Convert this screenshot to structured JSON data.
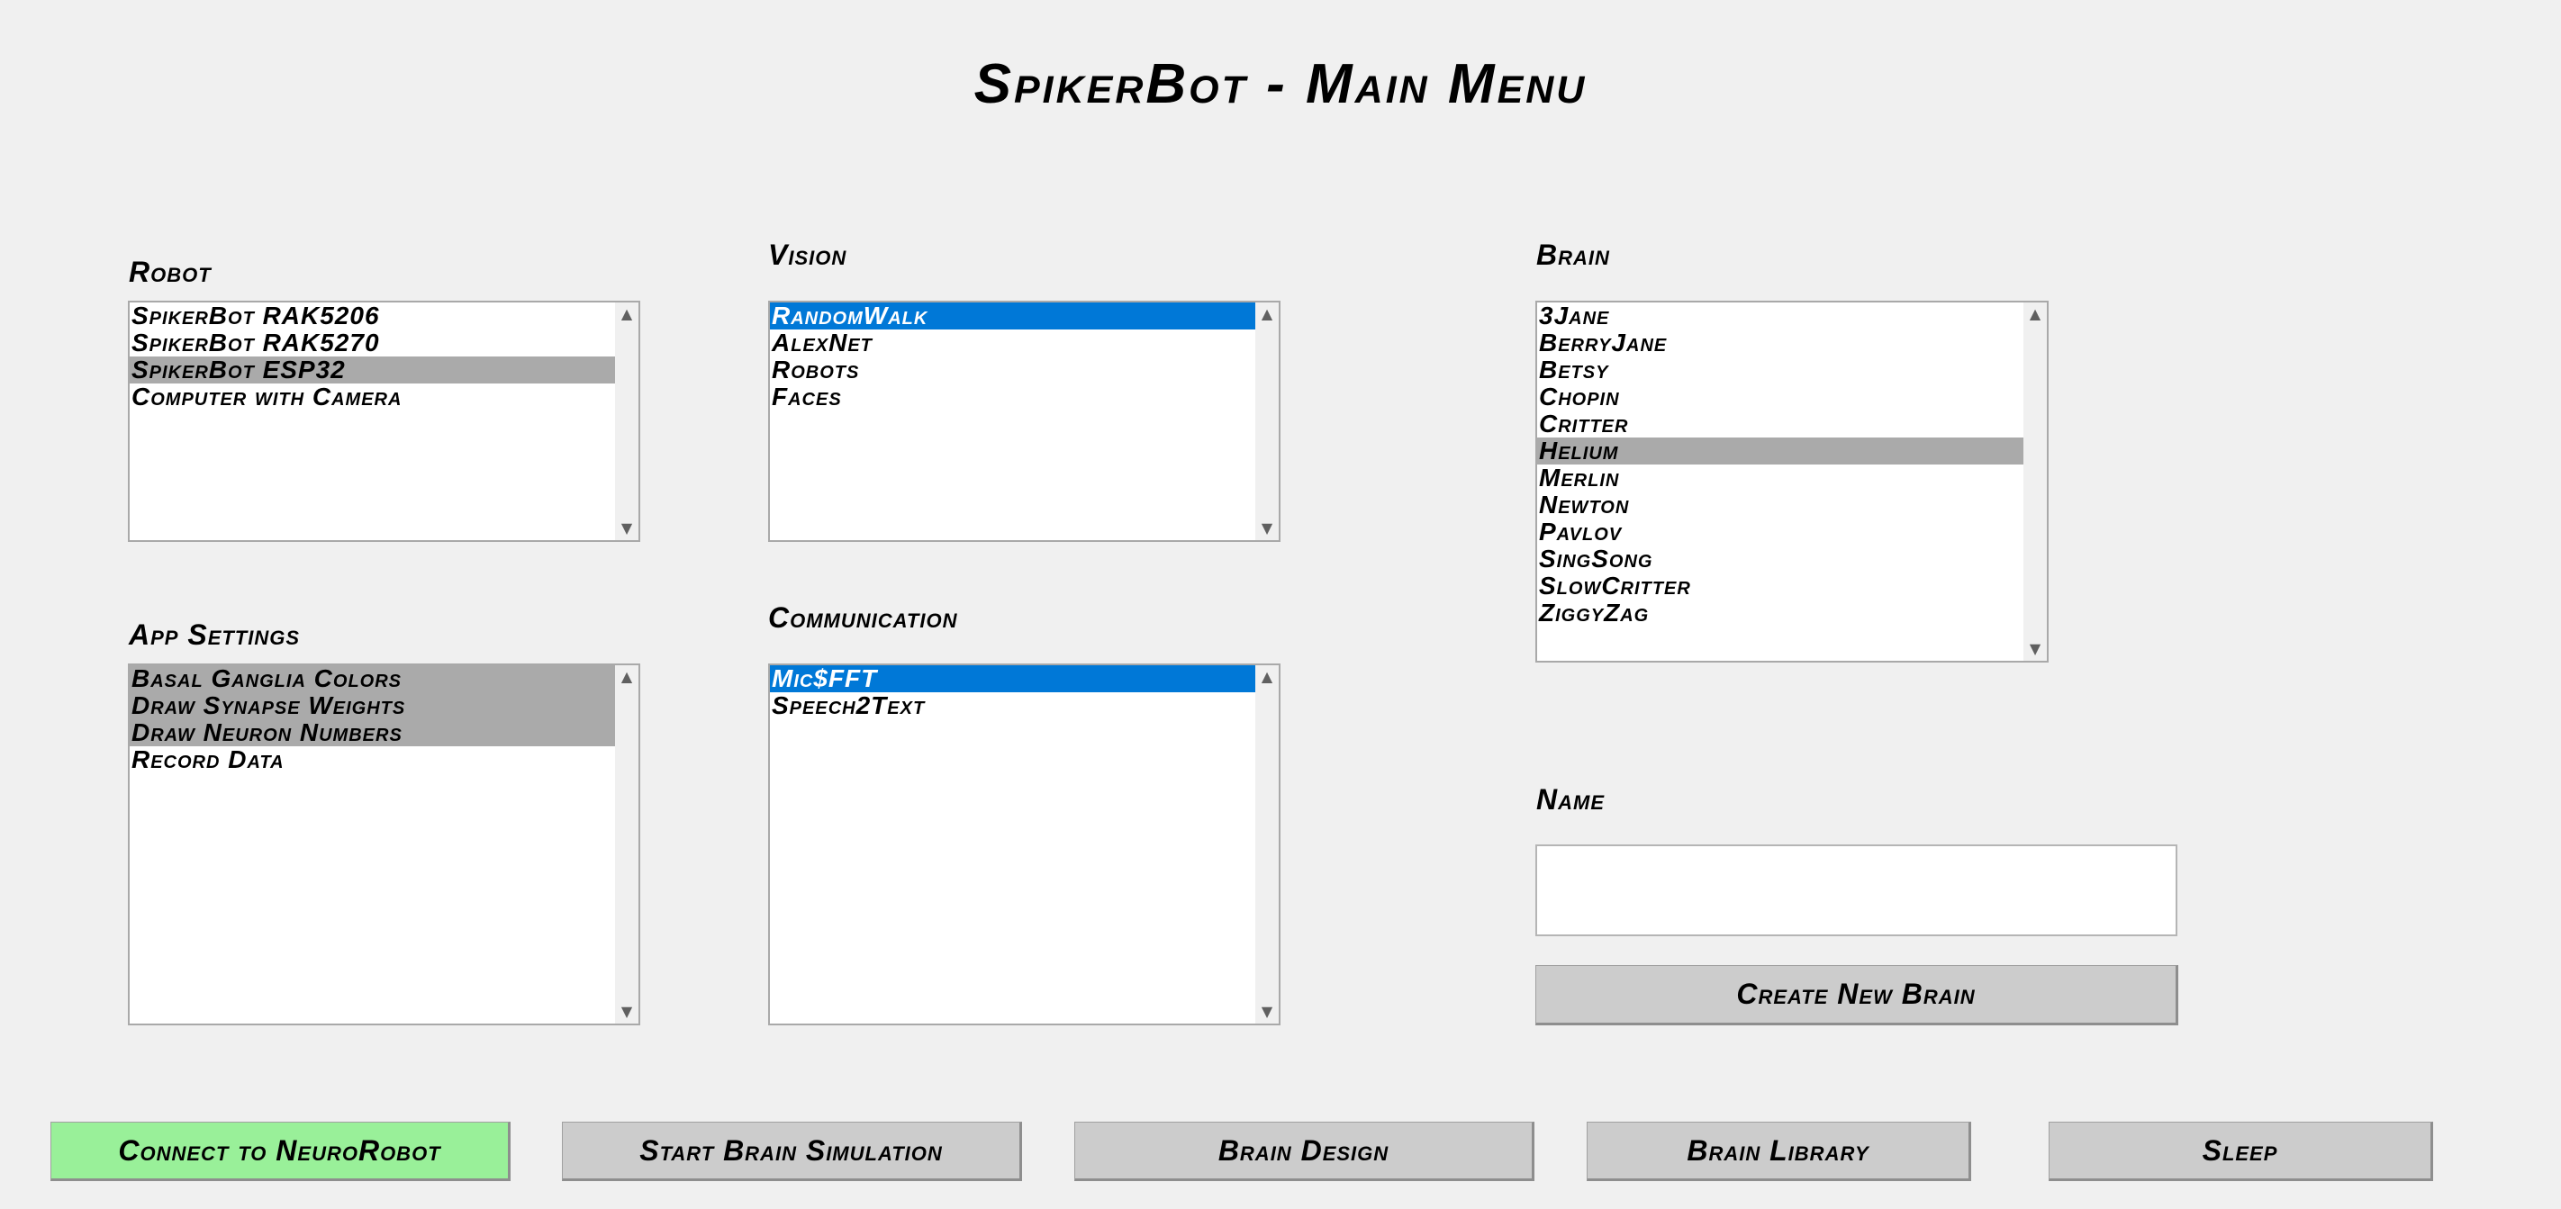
{
  "title": "SpikerBot - Main Menu",
  "colors": {
    "background": "#f0f0f0",
    "selection_blue": "#0078d7",
    "selection_gray": "#aaaaaa",
    "button_gray": "#cccccc",
    "button_green": "#99f099"
  },
  "robot": {
    "label": "Robot",
    "items": [
      "SpikerBot RAK5206",
      "SpikerBot RAK5270",
      "SpikerBot ESP32",
      "Computer with Camera"
    ],
    "selected": "SpikerBot ESP32"
  },
  "vision": {
    "label": "Vision",
    "items": [
      "RandomWalk",
      "AlexNet",
      "Robots",
      "Faces"
    ],
    "selected": "RandomWalk"
  },
  "brain": {
    "label": "Brain",
    "items": [
      "3Jane",
      "BerryJane",
      "Betsy",
      "Chopin",
      "Critter",
      "Helium",
      "Merlin",
      "Newton",
      "Pavlov",
      "SingSong",
      "SlowCritter",
      "ZiggyZag"
    ],
    "selected": "Helium"
  },
  "app_settings": {
    "label": "App Settings",
    "items": [
      "Basal Ganglia Colors",
      "Draw Synapse Weights",
      "Draw Neuron Numbers",
      "Record Data"
    ],
    "selected": [
      "Basal Ganglia Colors",
      "Draw Synapse Weights",
      "Draw Neuron Numbers"
    ]
  },
  "communication": {
    "label": "Communication",
    "items": [
      "Mic$FFT",
      "Speech2Text"
    ],
    "selected": "Mic$FFT"
  },
  "name": {
    "label": "Name",
    "value": "",
    "placeholder": ""
  },
  "create_new_brain_label": "Create New Brain",
  "bottom_buttons": {
    "connect": "Connect to NeuroRobot",
    "start": "Start Brain Simulation",
    "design": "Brain Design",
    "library": "Brain Library",
    "sleep": "Sleep"
  },
  "scroll_icons": {
    "up": "▲",
    "down": "▼"
  }
}
